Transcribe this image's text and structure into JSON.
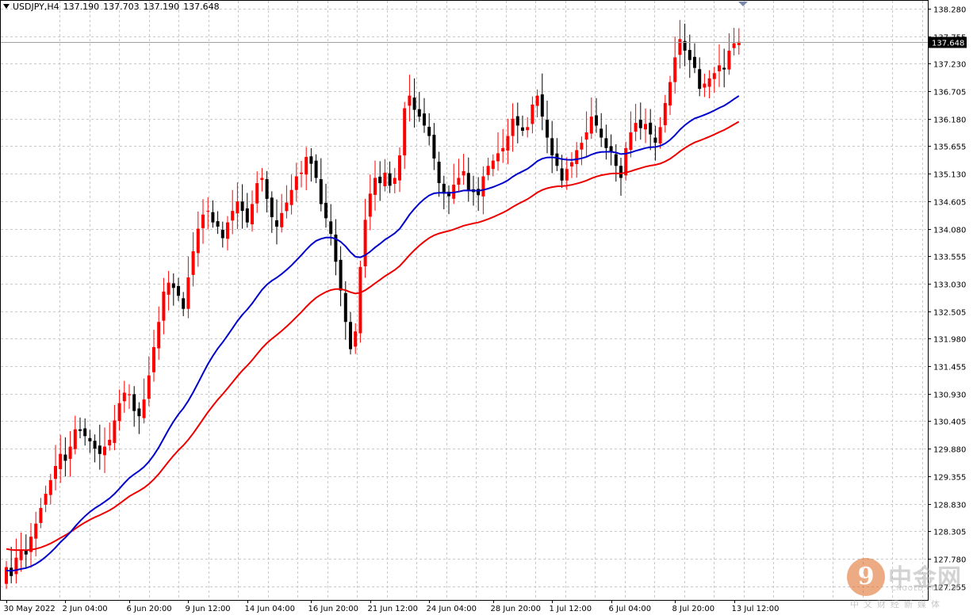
{
  "header": {
    "symbol": "USDJPY,H4",
    "open": "137.190",
    "high": "137.703",
    "low": "137.190",
    "close": "137.648"
  },
  "price_tag": "137.648",
  "watermark": {
    "brand_cn": "中金网",
    "url": "CNGOLD.COM.CN",
    "sub": "中文财经新媒体"
  },
  "colors": {
    "bull": "#ff0000",
    "bear": "#000000",
    "ma_fast": "#0000cc",
    "ma_slow": "#ee0000",
    "grid": "#c8c8c8",
    "price_line": "#a0a0a0"
  },
  "chart_data": {
    "type": "candlestick",
    "title": "",
    "symbol": "USDJPY",
    "timeframe": "H4",
    "ylim": [
      127.25,
      138.28
    ],
    "y_ticks": [
      138.28,
      137.755,
      137.23,
      136.705,
      136.18,
      135.655,
      135.13,
      134.605,
      134.08,
      133.555,
      133.03,
      132.505,
      131.98,
      131.455,
      130.93,
      130.405,
      129.88,
      129.355,
      128.83,
      128.305,
      127.78,
      127.255
    ],
    "y_tick_labels": [
      "138.280",
      "137.755",
      "137.230",
      "136.705",
      "136.180",
      "135.655",
      "135.130",
      "134.605",
      "134.080",
      "133.555",
      "133.030",
      "132.505",
      "131.980",
      "131.455",
      "130.930",
      "130.405",
      "129.880",
      "129.355",
      "128.830",
      "128.305",
      "127.780",
      "127.255"
    ],
    "x_tick_labels": [
      {
        "bar": 0,
        "label": "30 May 2022"
      },
      {
        "bar": 12,
        "label": "2 Jun 04:00"
      },
      {
        "bar": 25,
        "label": "6 Jun 20:00"
      },
      {
        "bar": 37,
        "label": "9 Jun 12:00"
      },
      {
        "bar": 49,
        "label": "14 Jun 04:00"
      },
      {
        "bar": 62,
        "label": "16 Jun 20:00"
      },
      {
        "bar": 74,
        "label": "21 Jun 12:00"
      },
      {
        "bar": 86,
        "label": "24 Jun 04:00"
      },
      {
        "bar": 99,
        "label": "28 Jun 20:00"
      },
      {
        "bar": 111,
        "label": "1 Jul 12:00"
      },
      {
        "bar": 123,
        "label": "6 Jul 04:00"
      },
      {
        "bar": 136,
        "label": "8 Jul 20:00"
      },
      {
        "bar": 148,
        "label": "13 Jul 12:00"
      }
    ],
    "current_price": 137.648,
    "series_ohlc": {
      "name": "USDJPY",
      "close": [
        127.62,
        127.45,
        127.8,
        127.95,
        127.86,
        128.2,
        128.45,
        128.75,
        129.02,
        129.28,
        129.55,
        129.78,
        129.65,
        129.92,
        130.25,
        130.22,
        130.12,
        130.02,
        129.88,
        129.78,
        129.92,
        130.05,
        130.42,
        130.75,
        130.95,
        130.92,
        130.6,
        130.5,
        130.82,
        131.28,
        131.82,
        132.3,
        132.88,
        133.05,
        132.95,
        132.8,
        132.55,
        133.15,
        133.65,
        134.08,
        134.35,
        134.42,
        134.2,
        134.12,
        133.9,
        134.2,
        134.42,
        134.6,
        134.42,
        134.2,
        134.55,
        134.95,
        135.05,
        134.65,
        134.3,
        134.12,
        134.38,
        134.58,
        134.82,
        135.08,
        135.15,
        135.45,
        135.32,
        135.05,
        134.55,
        134.28,
        133.98,
        133.45,
        132.9,
        132.3,
        131.78,
        132.12,
        133.35,
        134.25,
        134.75,
        135.05,
        134.95,
        135.15,
        134.9,
        135.05,
        135.48,
        136.38,
        136.62,
        136.35,
        136.22,
        136.05,
        135.85,
        135.42,
        134.95,
        134.75,
        134.7,
        134.92,
        135.05,
        135.18,
        134.82,
        134.78,
        134.72,
        135.08,
        135.28,
        135.38,
        135.52,
        135.62,
        135.85,
        136.18,
        136.05,
        135.95,
        136.02,
        136.45,
        136.62,
        136.22,
        135.82,
        135.48,
        135.28,
        135.0,
        135.22,
        135.35,
        135.58,
        135.72,
        135.92,
        136.22,
        136.05,
        135.82,
        135.62,
        135.55,
        135.28,
        135.05,
        135.62,
        135.92,
        136.1,
        136.0,
        136.08,
        135.88,
        135.72,
        136.02,
        136.48,
        136.88,
        137.35,
        137.7,
        137.48,
        137.3,
        137.15,
        136.75,
        136.85,
        136.95,
        137.05,
        137.2,
        137.12,
        137.48,
        137.62,
        137.648
      ],
      "note": ""
    },
    "series": [
      {
        "name": "",
        "color": "#0000cc"
      },
      {
        "name": "",
        "color": "#ee0000"
      }
    ],
    "grid": true,
    "legend": "none"
  }
}
